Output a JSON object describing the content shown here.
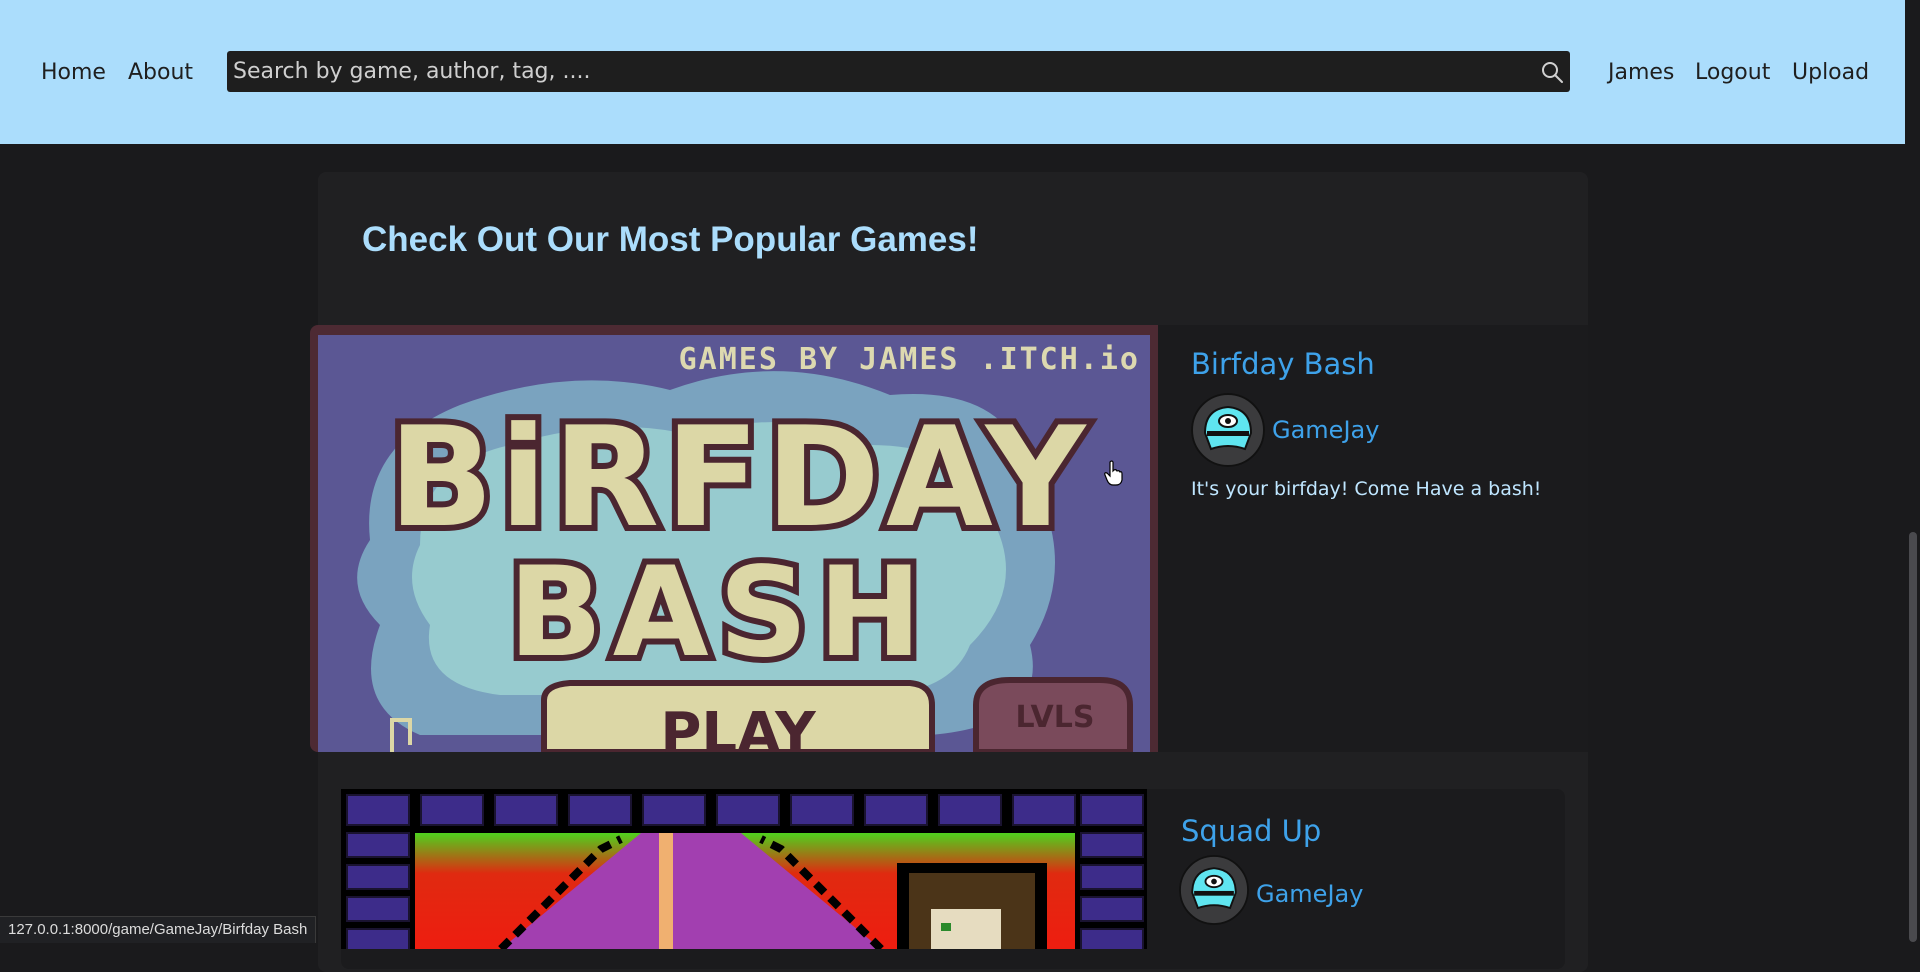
{
  "nav": {
    "home": "Home",
    "about": "About",
    "search_placeholder": "Search by game, author, tag, ....",
    "user": "James",
    "logout": "Logout",
    "upload": "Upload"
  },
  "main": {
    "title": "Check Out Our Most Popular Games!",
    "games": [
      {
        "title": "Birfday Bash",
        "author": "GameJay",
        "description": "It's your birfday! Come Have a bash!",
        "thumbnail_text": "GAMES BY JAMES .ITCH.io",
        "thumbnail_logo": "BiRFDAY BASH",
        "thumbnail_buttons": [
          "PLAY",
          "LVLS"
        ]
      },
      {
        "title": "Squad Up",
        "author": "GameJay"
      }
    ]
  },
  "status_bar": {
    "url": "127.0.0.1:8000/game/GameJay/Birfday Bash"
  },
  "colors": {
    "navbar_bg": "#abddfc",
    "page_bg": "#1a1a1c",
    "panel_bg": "#202022",
    "link": "#3ea2ea",
    "heading": "#abddfc"
  },
  "icons": {
    "search": "search-icon",
    "cursor": "hand-pointer-icon"
  }
}
